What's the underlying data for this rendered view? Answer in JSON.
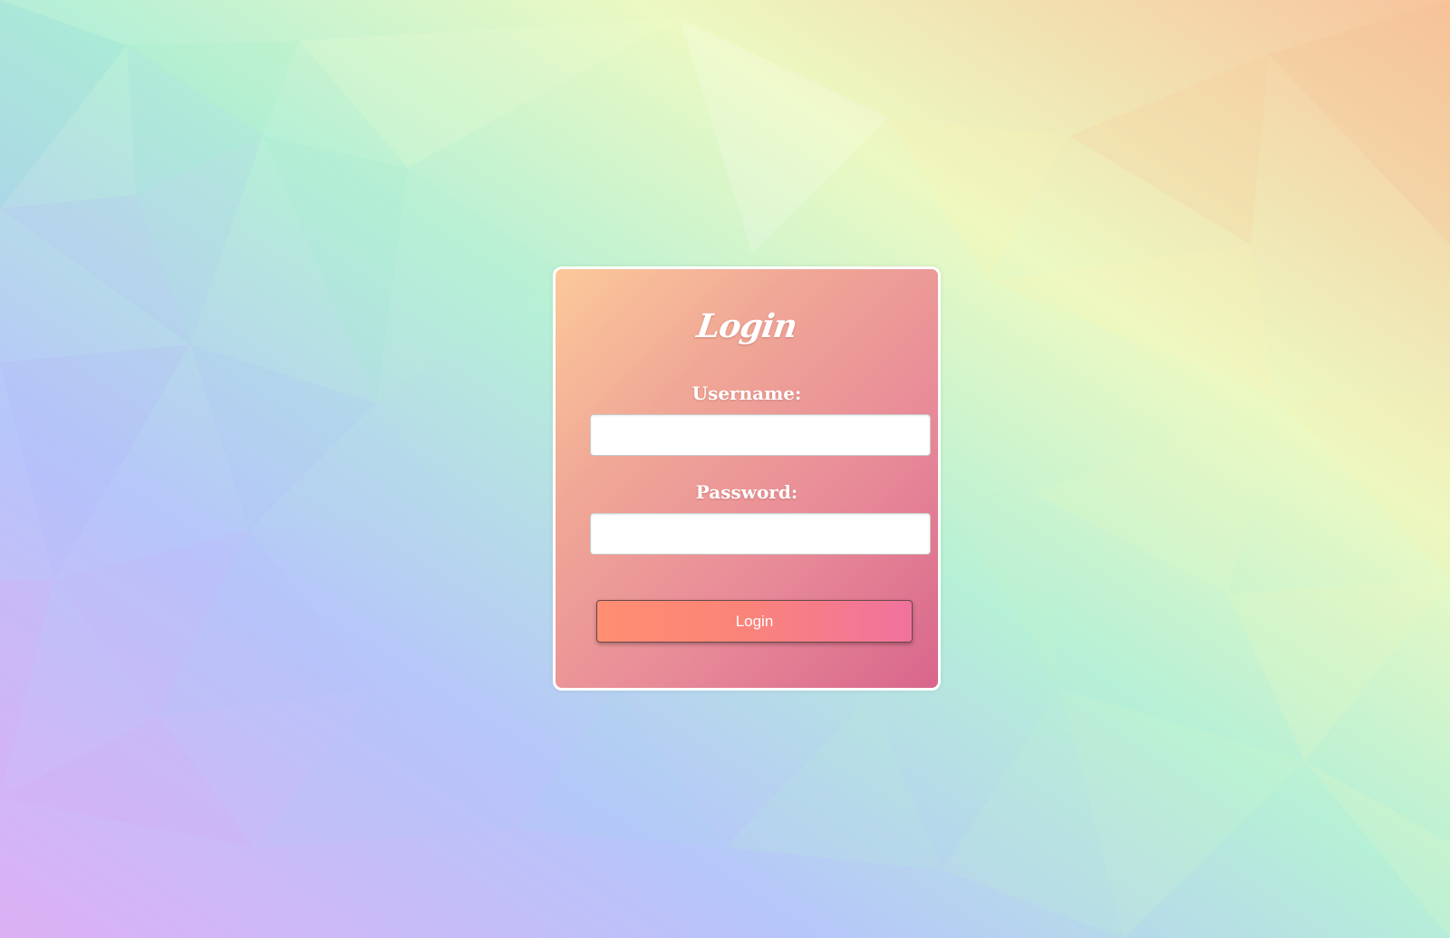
{
  "page": {
    "background_style": "low-poly pastel rainbow",
    "colors": {
      "card_gradient_start": "#fcc99a",
      "card_gradient_end": "#d8668c",
      "button_gradient_start": "#ff8e72",
      "button_gradient_end": "#f0729e"
    }
  },
  "login_form": {
    "title": "Login",
    "username_label": "Username:",
    "username_value": "",
    "password_label": "Password:",
    "password_value": "",
    "submit_label": "Login"
  }
}
